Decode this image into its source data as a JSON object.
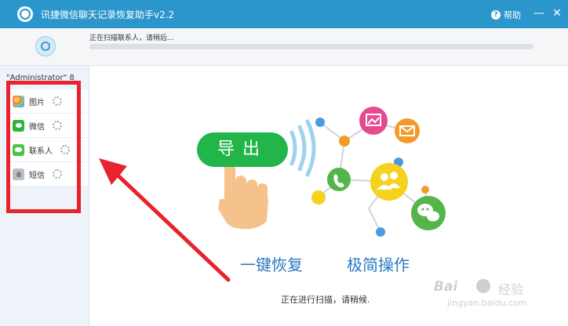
{
  "window": {
    "title": "讯捷微信聊天记录恢复助手v2.2",
    "help_label": "帮助",
    "minimize_glyph": "—",
    "close_glyph": "✕",
    "accent_color": "#2a96cc"
  },
  "scan": {
    "status_text": "正在扫描联系人，请稍后...",
    "progress": 0
  },
  "sidebar": {
    "user_label": "\"Administrator\" 8",
    "items": [
      {
        "label": "图片",
        "icon": "photos-icon"
      },
      {
        "label": "微信",
        "icon": "wechat-icon"
      },
      {
        "label": "联系人",
        "icon": "contacts-icon"
      },
      {
        "label": "短信",
        "icon": "sms-icon"
      }
    ]
  },
  "hero": {
    "export_label": "导出",
    "slogan_left": "一键恢复",
    "slogan_right": "极简操作",
    "status_text": "正在进行扫描，请稍候.",
    "icons": [
      "hand-pointer-icon",
      "signal-waves-icon",
      "image-icon",
      "mail-icon",
      "phone-icon",
      "contacts-icon",
      "wechat-icon"
    ]
  },
  "annotation": {
    "color": "#e8232d"
  },
  "watermark": {
    "brand": "Bai",
    "title": "经验",
    "url": "jingyan.baidu.com"
  }
}
